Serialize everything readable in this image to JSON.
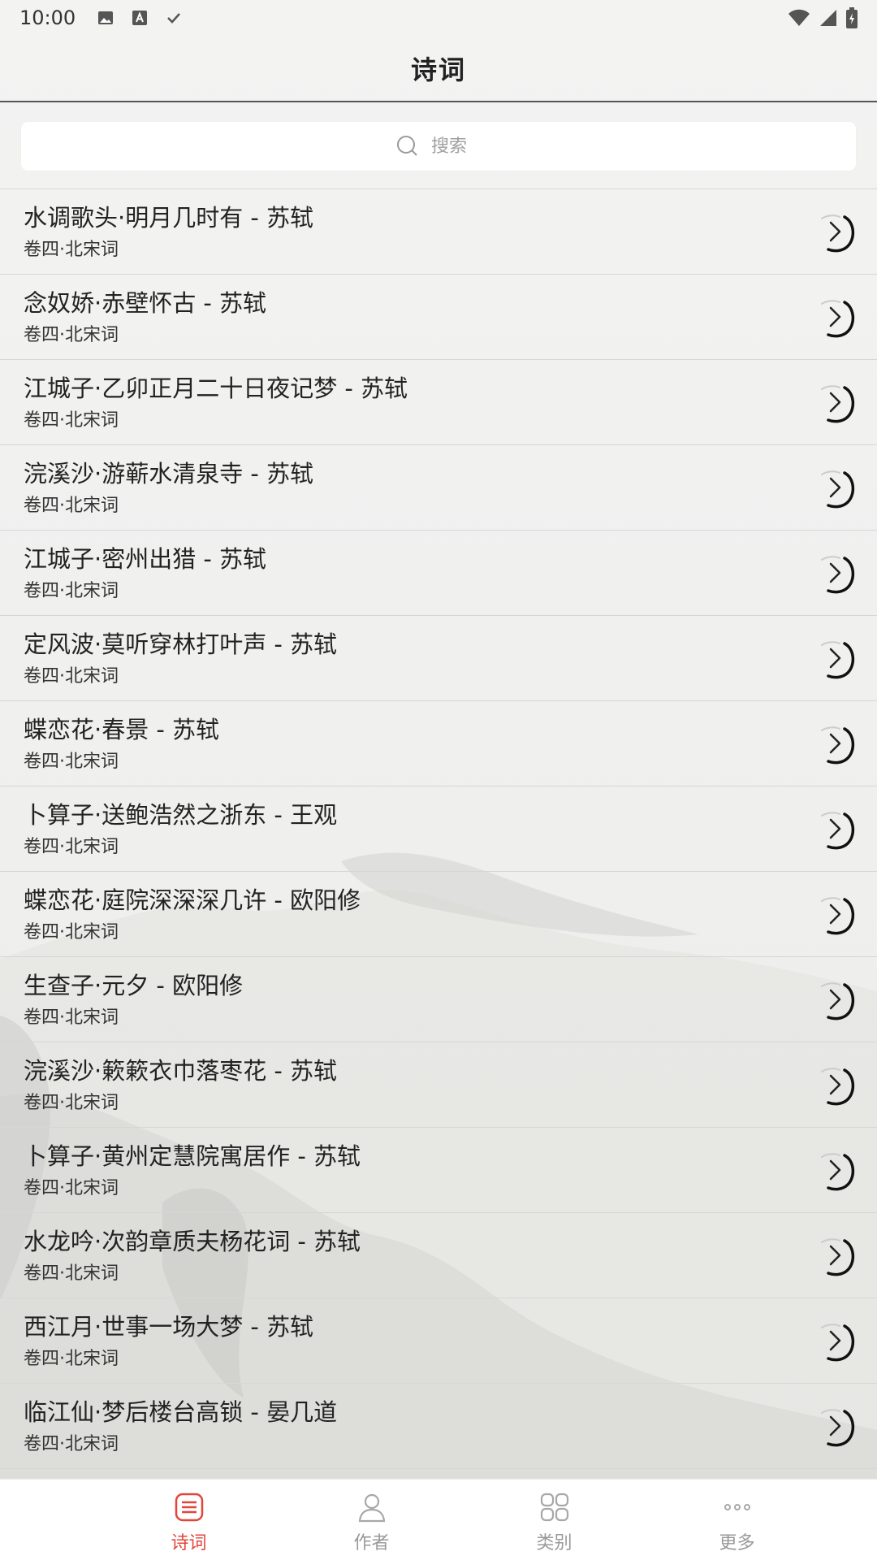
{
  "status_bar": {
    "time": "10:00"
  },
  "header": {
    "title": "诗词"
  },
  "search": {
    "placeholder": "搜索"
  },
  "poems": [
    {
      "title": "水调歌头·明月几时有 - 苏轼",
      "subtitle": "卷四·北宋词"
    },
    {
      "title": "念奴娇·赤壁怀古 - 苏轼",
      "subtitle": "卷四·北宋词"
    },
    {
      "title": "江城子·乙卯正月二十日夜记梦 - 苏轼",
      "subtitle": "卷四·北宋词"
    },
    {
      "title": "浣溪沙·游蕲水清泉寺 - 苏轼",
      "subtitle": "卷四·北宋词"
    },
    {
      "title": "江城子·密州出猎 - 苏轼",
      "subtitle": "卷四·北宋词"
    },
    {
      "title": "定风波·莫听穿林打叶声 - 苏轼",
      "subtitle": "卷四·北宋词"
    },
    {
      "title": "蝶恋花·春景 - 苏轼",
      "subtitle": "卷四·北宋词"
    },
    {
      "title": "卜算子·送鲍浩然之浙东 - 王观",
      "subtitle": "卷四·北宋词"
    },
    {
      "title": "蝶恋花·庭院深深深几许 - 欧阳修",
      "subtitle": "卷四·北宋词"
    },
    {
      "title": "生查子·元夕 - 欧阳修",
      "subtitle": "卷四·北宋词"
    },
    {
      "title": "浣溪沙·簌簌衣巾落枣花 - 苏轼",
      "subtitle": "卷四·北宋词"
    },
    {
      "title": "卜算子·黄州定慧院寓居作 - 苏轼",
      "subtitle": "卷四·北宋词"
    },
    {
      "title": "水龙吟·次韵章质夫杨花词 - 苏轼",
      "subtitle": "卷四·北宋词"
    },
    {
      "title": "西江月·世事一场大梦 - 苏轼",
      "subtitle": "卷四·北宋词"
    },
    {
      "title": "临江仙·梦后楼台高锁 - 晏几道",
      "subtitle": "卷四·北宋词"
    }
  ],
  "tabs": [
    {
      "label": "诗词",
      "icon": "poetry-icon",
      "active": true
    },
    {
      "label": "作者",
      "icon": "person-icon",
      "active": false
    },
    {
      "label": "类别",
      "icon": "grid-icon",
      "active": false
    },
    {
      "label": "更多",
      "icon": "more-dots-icon",
      "active": false
    }
  ],
  "colors": {
    "accent": "#e2463a",
    "inactive": "#999999"
  }
}
